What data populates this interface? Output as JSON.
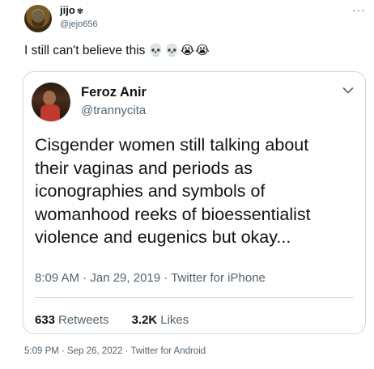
{
  "outer_tweet": {
    "name": "jijo",
    "name_emoji": "✾",
    "handle": "@jejo656",
    "more_label": "···",
    "text": "I still can't believe this",
    "text_emojis": "💀💀😭😭",
    "meta": "5:09 PM · Sep 26, 2022 · Twitter for Android"
  },
  "quoted_tweet": {
    "name": "Feroz Anir",
    "handle": "@trannycita",
    "body_lines": [
      "Cisgender women still talking about",
      "their vaginas and periods as",
      "iconographies and symbols of",
      "womanhood reeks of bioessentialist",
      "violence and eugenics but okay..."
    ],
    "meta": "8:09 AM · Jan 29, 2019 · Twitter for iPhone",
    "retweets_count": "633",
    "retweets_label": "Retweets",
    "likes_count": "3.2K",
    "likes_label": "Likes"
  }
}
